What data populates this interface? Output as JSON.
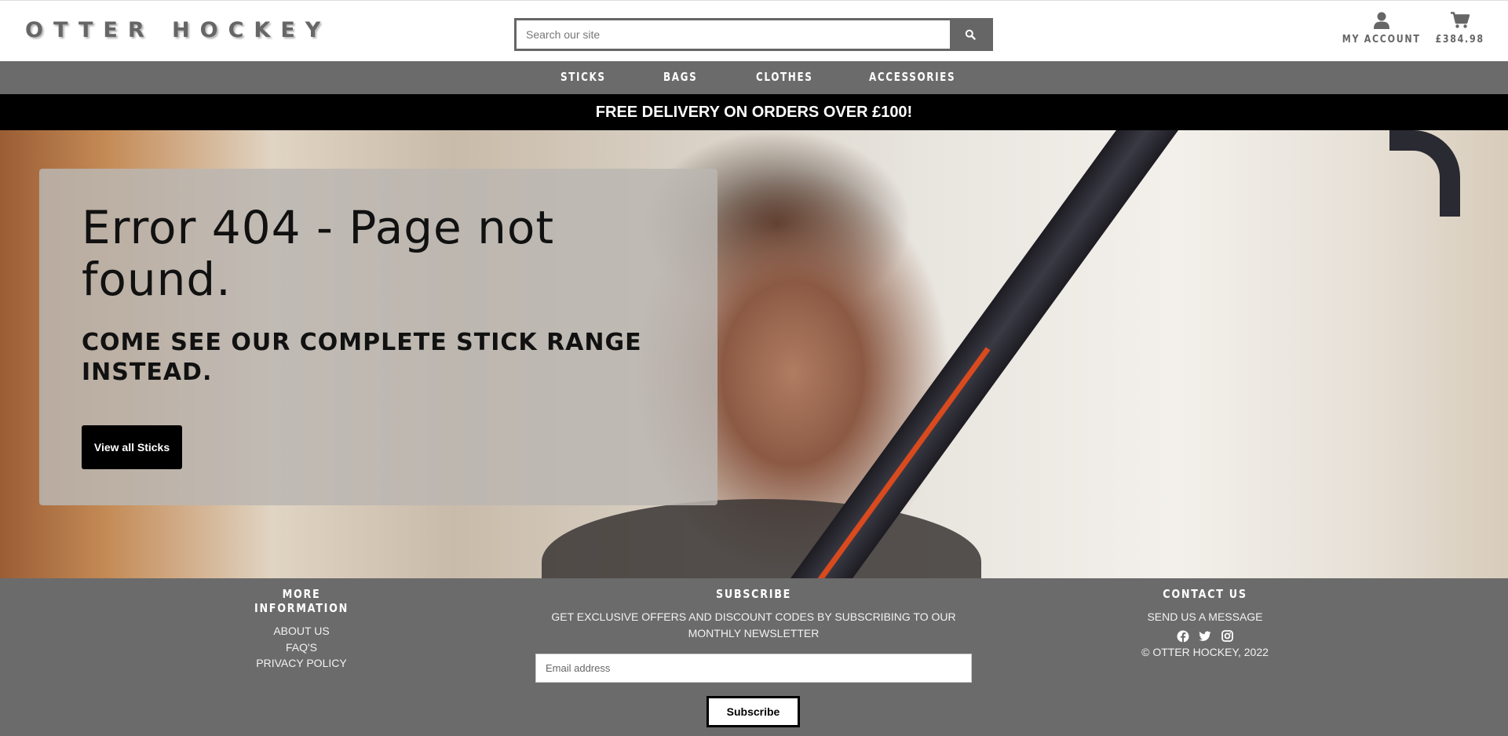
{
  "header": {
    "logo": "OTTER HOCKEY",
    "search_placeholder": "Search our site",
    "my_account": "MY ACCOUNT",
    "cart_total": "£384.98"
  },
  "nav": {
    "items": [
      "STICKS",
      "BAGS",
      "CLOTHES",
      "ACCESSORIES"
    ]
  },
  "banner": {
    "text": "FREE DELIVERY ON ORDERS OVER £100!"
  },
  "hero": {
    "title": "Error 404 - Page not found.",
    "subtitle": "COME SEE OUR COMPLETE STICK RANGE INSTEAD.",
    "button": "View all Sticks"
  },
  "footer": {
    "info": {
      "heading": "MORE INFORMATION",
      "links": [
        "ABOUT US",
        "FAQ'S",
        "PRIVACY POLICY"
      ]
    },
    "subscribe": {
      "heading": "SUBSCRIBE",
      "text": "GET EXCLUSIVE OFFERS AND DISCOUNT CODES BY SUBSCRIBING TO OUR MONTHLY NEWSLETTER",
      "email_placeholder": "Email address",
      "button": "Subscribe"
    },
    "contact": {
      "heading": "CONTACT US",
      "link": "SEND US A MESSAGE",
      "socials": [
        "facebook-icon",
        "twitter-icon",
        "instagram-icon"
      ],
      "copyright": "© OTTER HOCKEY, 2022"
    }
  }
}
